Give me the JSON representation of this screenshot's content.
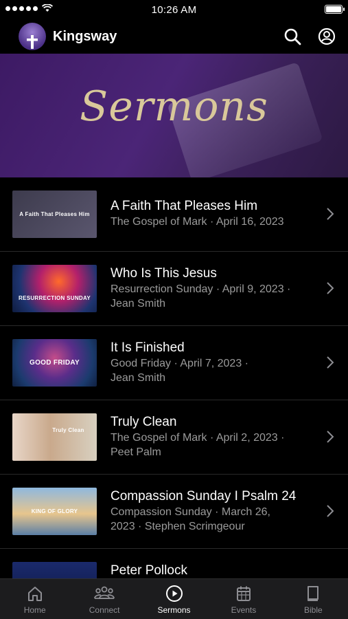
{
  "status_bar": {
    "time": "10:26 AM"
  },
  "header": {
    "title": "Kingsway"
  },
  "banner": {
    "title": "Sermons"
  },
  "sermons": [
    {
      "title": "A Faith That Pleases Him",
      "meta_line1": "The Gospel of Mark · April 16, 2023",
      "meta_line2": "",
      "thumbnail_text": "A Faith That Pleases Him"
    },
    {
      "title": "Who Is This Jesus",
      "meta_line1": "Resurrection Sunday · April 9, 2023 ·",
      "meta_line2": "Jean Smith",
      "thumbnail_text": "RESURRECTION SUNDAY"
    },
    {
      "title": "It Is Finished",
      "meta_line1": "Good Friday · April 7, 2023 ·",
      "meta_line2": "Jean Smith",
      "thumbnail_text": "GOOD FRIDAY"
    },
    {
      "title": "Truly Clean",
      "meta_line1": "The Gospel of Mark · April 2, 2023 ·",
      "meta_line2": "Peet Palm",
      "thumbnail_text": "Truly Clean"
    },
    {
      "title": "Compassion Sunday I Psalm 24",
      "meta_line1": "Compassion Sunday · March 26,",
      "meta_line2": "2023 · Stephen Scrimgeour",
      "thumbnail_text": "KING OF GLORY"
    },
    {
      "title": "Peter Pollock",
      "meta_line1": "",
      "meta_line2": "",
      "thumbnail_text": ""
    }
  ],
  "tabbar": {
    "tabs": [
      {
        "label": "Home",
        "icon": "home-icon"
      },
      {
        "label": "Connect",
        "icon": "people-icon"
      },
      {
        "label": "Sermons",
        "icon": "play-circle-icon",
        "active": true
      },
      {
        "label": "Events",
        "icon": "calendar-icon"
      },
      {
        "label": "Bible",
        "icon": "book-icon"
      }
    ]
  },
  "colors": {
    "background": "#000000",
    "accent_purple": "#4b2577",
    "banner_script": "#d9c89a",
    "meta_text": "#9b9b9b",
    "tab_inactive": "#8e8e93"
  }
}
